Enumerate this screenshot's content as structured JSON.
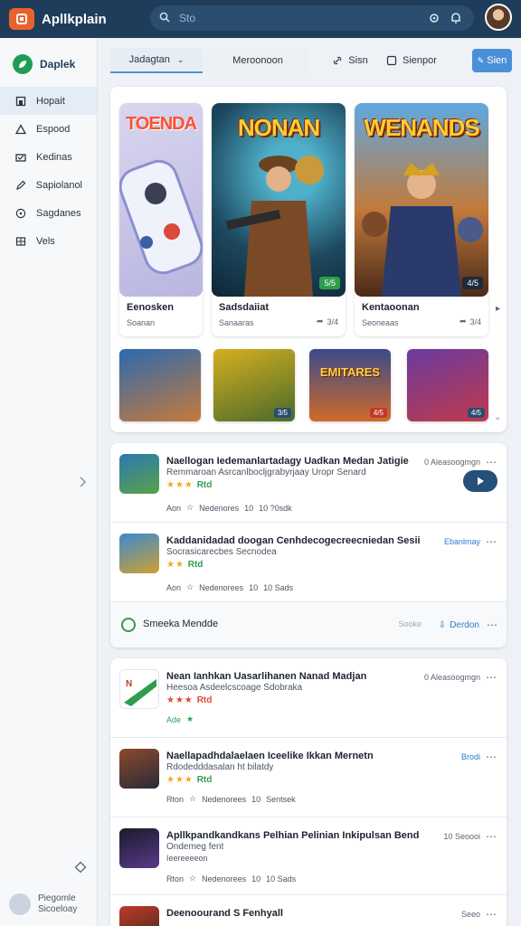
{
  "app": {
    "title": "Apllkplain"
  },
  "search": {
    "placeholder": "Sto"
  },
  "sidebar": {
    "brand": "Daplek",
    "items": [
      {
        "label": "Hopait",
        "icon": "home-icon"
      },
      {
        "label": "Espood",
        "icon": "triangle-icon"
      },
      {
        "label": "Kedinas",
        "icon": "folder-icon"
      },
      {
        "label": "Sapiolanol",
        "icon": "pencil-icon"
      },
      {
        "label": "Sagdanes",
        "icon": "compass-icon"
      },
      {
        "label": "Vels",
        "icon": "grid-icon"
      }
    ],
    "footer": {
      "line1": "Piegomle",
      "line2": "Sicoeloay"
    }
  },
  "tabs": {
    "select_label": "Jadagtan",
    "plain_label": "Meroonoon",
    "ghost1_label": "Sisn",
    "ghost2_label": "Sienpor",
    "primary_label": "Sien"
  },
  "featured": {
    "cards": [
      {
        "art_title": "TOENDA",
        "name": "Eenosken",
        "meta": "Soanan",
        "meta_r": "",
        "badge": ""
      },
      {
        "art_title": "NONAN",
        "name": "Sadsdaiiat",
        "meta": "Sanaaras",
        "meta_r": "3/4",
        "badge": "5/5"
      },
      {
        "art_title": "WENANDS",
        "name": "Kentaoonan",
        "meta": "Seoneaas",
        "meta_r": "3/4",
        "badge": "4/5"
      }
    ],
    "thumbs": [
      {
        "title": "",
        "badge": ""
      },
      {
        "title": "",
        "badge": "3/5"
      },
      {
        "title": "EMITARES",
        "badge": "4/5"
      },
      {
        "title": "",
        "badge": "4/5"
      }
    ]
  },
  "list1": {
    "rows": [
      {
        "title": "Naellogan Iedemanlartadagy Uadkan Medan Jatigie",
        "subtitle": "Remmaroan Asrcanlbocljgrabyrjaay Uropr Senard",
        "stars": "★★★",
        "rating_tag": "Rtd",
        "foot_a": "Aon",
        "foot_b": "Nedenores",
        "foot_c": "10",
        "foot_d": "10 ?0sdk",
        "right_text": "0 Aleasoogmgn"
      },
      {
        "title": "Kaddanidadad doogan Cenhdecogecreecniedan Sesiirgen",
        "subtitle": "Socrasicarecbes Secnodea",
        "stars": "★★",
        "rating_tag": "Rtd",
        "foot_a": "Aon",
        "foot_b": "Nedenorees",
        "foot_c": "10",
        "foot_d": "10 Sads",
        "right_text": "Ebanlmay"
      }
    ],
    "footer": {
      "label": "Smeeka Mendde",
      "dim": "Sooke",
      "action": "Derdon"
    }
  },
  "list2": {
    "rows": [
      {
        "title": "Nean Ianhkan Uasarlihanen Nanad Madjan",
        "subtitle": "Heesoa Asdeelcscoage Sdobraka",
        "stars": "★★★",
        "rating_tag": "Rtd",
        "extra": "Ade",
        "right_text": "0 Aleasoogmgn"
      },
      {
        "title": "Naellapadhdalaelaen Iceelike Ikkan Mernetn",
        "subtitle": "Rdodedddasalan ht bilatdy",
        "stars": "★★★",
        "rating_tag": "Rtd",
        "foot_a": "Rton",
        "foot_b": "Nedenorees",
        "foot_c": "10",
        "foot_d": "Sentsek",
        "right_text": "Brodi"
      },
      {
        "title": "Apllkpandkandkans Pelhian Pelinian Inkipulsan Bendanaan",
        "subtitle": "Ondemeg fent",
        "subtitle2": "Ieereeeeon",
        "foot_a": "Rton",
        "foot_b": "Nedenorees",
        "foot_c": "10",
        "foot_d": "10 Sads",
        "right_text": "10 Seoooi"
      },
      {
        "title": "Deenoourand S Fenhyall",
        "subtitle": "",
        "right_text": "Seeo"
      }
    ]
  },
  "colors": {
    "topbar": "#1f3d5a",
    "accent": "#4a90d9",
    "logo": "#e8632b",
    "green": "#2e9e4e",
    "star": "#f4a621"
  }
}
